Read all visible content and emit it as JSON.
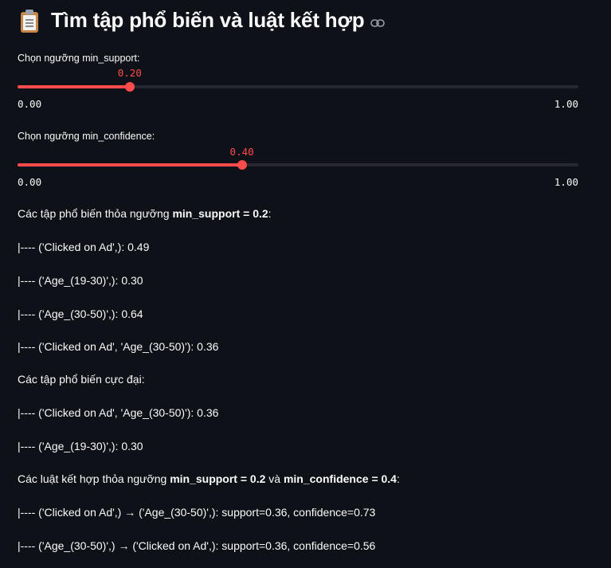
{
  "title": "Tìm tập phổ biến và luật kết hợp",
  "title_icon": "clipboard-icon",
  "accent_color": "#ff4b4b",
  "sliders": [
    {
      "label": "Chọn ngưỡng min_support:",
      "value_text": "0.20",
      "value": 0.2,
      "min_text": "0.00",
      "max_text": "1.00",
      "min": 0,
      "max": 1
    },
    {
      "label": "Chọn ngưỡng min_confidence:",
      "value_text": "0.40",
      "value": 0.4,
      "min_text": "0.00",
      "max_text": "1.00",
      "min": 0,
      "max": 1
    }
  ],
  "frequent_heading": {
    "prefix": "Các tập phổ biến thỏa ngưỡng ",
    "bold": "min_support = 0.2",
    "suffix": ":"
  },
  "frequent_items": [
    "|---- ('Clicked on Ad',): 0.49",
    "|---- ('Age_(19-30)',): 0.30",
    "|---- ('Age_(30-50)',): 0.64",
    "|---- ('Clicked on Ad', 'Age_(30-50)'): 0.36"
  ],
  "maximal_heading": "Các tập phổ biến cực đại:",
  "maximal_items": [
    "|---- ('Clicked on Ad', 'Age_(30-50)'): 0.36",
    "|---- ('Age_(19-30)',): 0.30"
  ],
  "rules_heading": {
    "prefix": "Các luật kết hợp thỏa ngưỡng ",
    "bold1": "min_support = 0.2",
    "middle": " và ",
    "bold2": "min_confidence = 0.4",
    "suffix": ":"
  },
  "rules": [
    "|---- ('Clicked on Ad',) → ('Age_(30-50)',): support=0.36, confidence=0.73",
    "|---- ('Age_(30-50)',) → ('Clicked on Ad',): support=0.36, confidence=0.56"
  ]
}
